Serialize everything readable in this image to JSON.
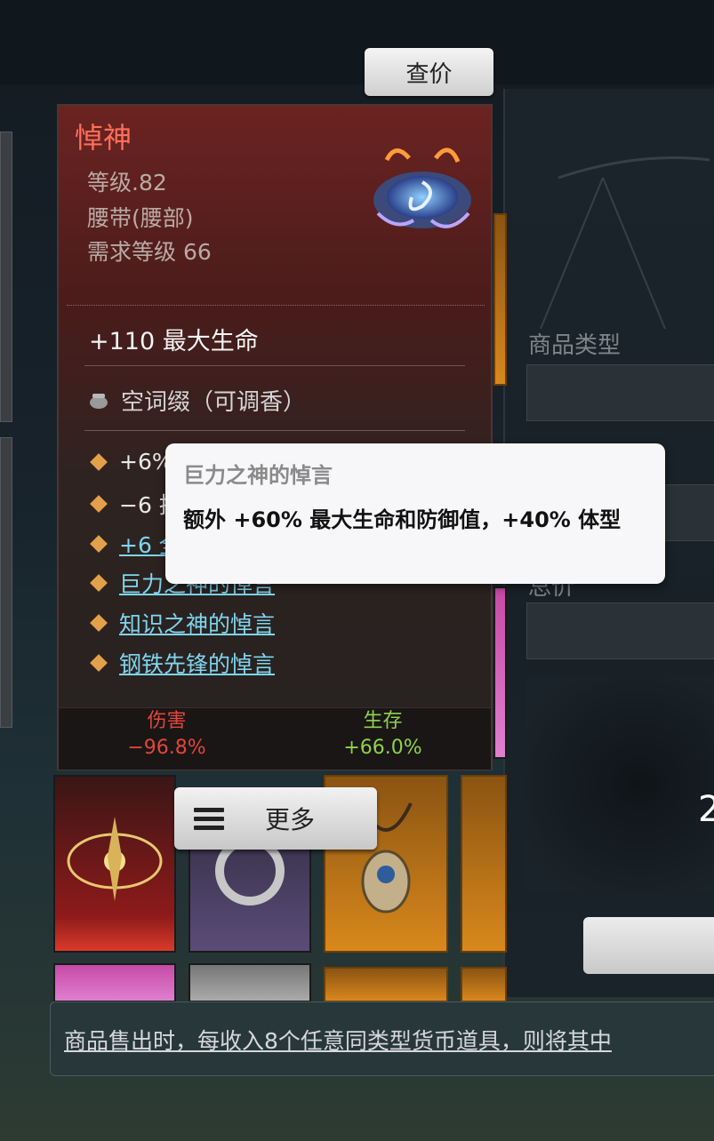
{
  "price_check": {
    "label": "查价"
  },
  "item": {
    "name": "悼神",
    "level": "等级.82",
    "type": "腰带(腰部)",
    "required_level": "需求等级 66",
    "main_stat": "+110 最大生命",
    "empty_affix": "空词缀（可调香）",
    "affixes": [
      {
        "text": "+6%",
        "link": false
      },
      {
        "text": "−6 技",
        "link": false
      },
      {
        "text": "+6 全",
        "link": false
      },
      {
        "text": "巨力之神的悼言",
        "link": true
      },
      {
        "text": "知识之神的悼言",
        "link": true
      },
      {
        "text": "钢铁先锋的悼言",
        "link": true
      }
    ],
    "footer": {
      "damage_label": "伤害",
      "damage_value": "−96.8%",
      "survival_label": "生存",
      "survival_value": "+66.0%"
    }
  },
  "tooltip": {
    "title": "巨力之神的悼言",
    "body": "额外 +60% 最大生命和防御值，+40% 体型"
  },
  "more_button": {
    "label": "更多"
  },
  "right_panel": {
    "product_type_label": "商品类型",
    "total_price_label": "总价",
    "amount": "2"
  },
  "notice": {
    "text": "商品售出时，每收入8个任意同类型货币道具，则将其中"
  },
  "colors": {
    "item_name": "#ff6e5c",
    "link": "#7fd5ee",
    "damage": "#e2463a",
    "survival": "#8ed34a",
    "affix_diamond": "#e3a04a"
  }
}
